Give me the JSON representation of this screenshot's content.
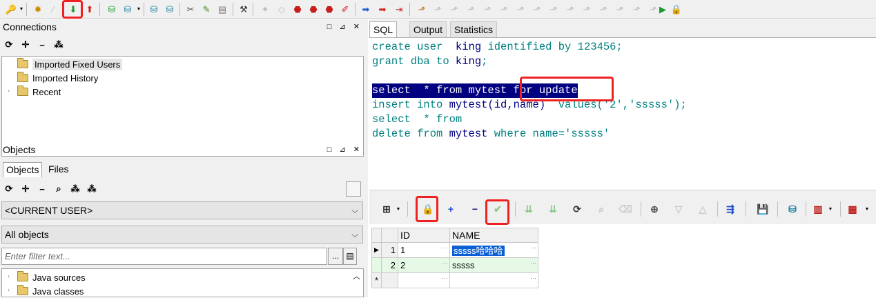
{
  "connections_panel": {
    "title": "Connections",
    "tree": [
      "Imported Fixed Users",
      "Imported History",
      "Recent"
    ]
  },
  "objects_panel": {
    "title": "Objects",
    "tabs": [
      "Objects",
      "Files"
    ],
    "user_combo": "<CURRENT USER>",
    "type_combo": "All objects",
    "filter_placeholder": "Enter filter text...",
    "filter_button": "...",
    "tree": [
      "Java sources",
      "Java classes"
    ]
  },
  "editor": {
    "tabs": [
      "SQL",
      "Output",
      "Statistics"
    ],
    "lines": [
      {
        "kw": "create user  ",
        "id": "king",
        "rest": " identified by 123456;"
      },
      {
        "kw": "grant dba to ",
        "id": "king",
        "rest": ";"
      },
      {
        "kw": "",
        "id": "",
        "rest": ""
      },
      {
        "kw": "select  * from ",
        "id": "mytest",
        "rest": " for update"
      },
      {
        "kw": "insert into ",
        "id": "mytest(id,name)",
        "rest": "  values('2','sssss');"
      },
      {
        "kw": "select  * from",
        "id": "",
        "rest": ""
      },
      {
        "kw": "delete from ",
        "id": "mytest",
        "rest": " where name='sssss'"
      }
    ]
  },
  "grid": {
    "columns": [
      "ID",
      "NAME"
    ],
    "rows": [
      {
        "num": "1",
        "id": "1",
        "name": "sssss哈哈哈"
      },
      {
        "num": "2",
        "id": "2",
        "name": "sssss"
      }
    ],
    "new_row_marker": "*"
  },
  "colors": {
    "highlight": "#ee2020",
    "selection": "#000080",
    "keyword": "#008080"
  }
}
